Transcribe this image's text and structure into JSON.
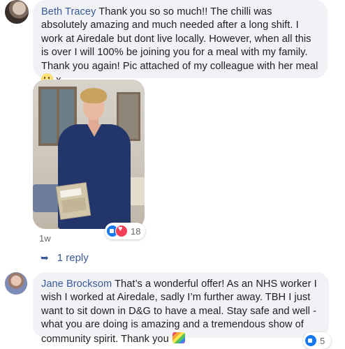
{
  "comment1": {
    "author": "Beth Tracey",
    "text": "Thank you so so much!! The chilli was absolutely amazing and much needed after a long shift. I work at Airedale but dont live locally. However, when all this is over I will 100% be joining you for a meal with my family. Thank you again! Pic attached of my colleague with her meal",
    "after_emoji": " x",
    "emoji_icon": "smiling-face-emoji",
    "reaction_count": "18",
    "time": "1w"
  },
  "replies": {
    "label": "1 reply"
  },
  "comment2": {
    "author": "Jane Brocksom",
    "text": "That’s a wonderful offer! As an NHS worker I wish I worked at Airedale, sadly I’m further away. TBH I just want to sit down in D&G to have a meal. Stay safe and well - what you are doing is amazing and a tremendous show of community spirit. Thank you",
    "emoji_icon": "rainbow-emoji",
    "reaction_count": "5"
  },
  "colors": {
    "author_link": "#385898",
    "bubble_bg": "#f0f2f5",
    "like_blue": "#1877f2",
    "love_red": "#f33e58",
    "meta_gray": "#65676b"
  }
}
